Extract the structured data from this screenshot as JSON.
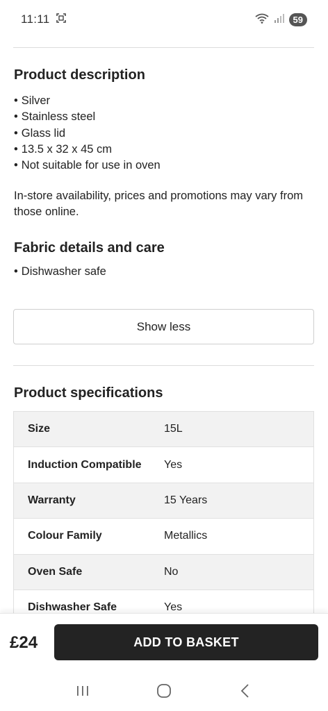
{
  "status_bar": {
    "time": "11:11",
    "battery": "59",
    "icons": [
      "screenshot-icon",
      "wifi-icon",
      "signal-icon"
    ]
  },
  "description": {
    "title": "Product description",
    "bullets": [
      "Silver",
      "Stainless steel",
      "Glass lid",
      "13.5 x 32 x 45 cm",
      "Not suitable for use in oven"
    ],
    "availability_note": "In-store availability, prices and promotions may vary from those online."
  },
  "fabric": {
    "title": "Fabric details and care",
    "bullets": [
      "Dishwasher safe"
    ]
  },
  "show_less_label": "Show less",
  "specifications": {
    "title": "Product specifications",
    "rows": [
      {
        "label": "Size",
        "value": "15L"
      },
      {
        "label": "Induction Compatible",
        "value": "Yes"
      },
      {
        "label": "Warranty",
        "value": "15 Years"
      },
      {
        "label": "Colour Family",
        "value": "Metallics"
      },
      {
        "label": "Oven Safe",
        "value": "No"
      },
      {
        "label": "Dishwasher Safe",
        "value": "Yes"
      }
    ]
  },
  "purchase": {
    "price": "£24",
    "add_label": "ADD TO BASKET"
  },
  "navigation": {
    "buttons": [
      "recent-apps-icon",
      "home-icon",
      "back-icon"
    ]
  },
  "colors": {
    "button_dark": "#232323",
    "row_shade": "#f2f2f2",
    "divider": "#dcdcdc"
  }
}
